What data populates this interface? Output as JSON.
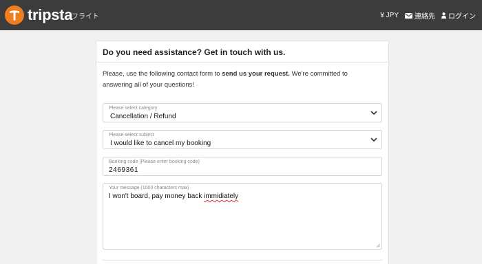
{
  "header": {
    "brand": "tripsta",
    "nav_flight": "フライト",
    "currency": "¥ JPY",
    "contact_label": "連絡先",
    "login_label": "ログイン"
  },
  "card": {
    "title": "Do you need assistance? Get in touch with us.",
    "intro_before": "Please, use the following contact form to ",
    "intro_bold": "send us your request.",
    "intro_after": " We're committed to answering all of your questions!"
  },
  "form": {
    "category": {
      "label": "Please select category",
      "value": "Cancellation / Refund"
    },
    "subject": {
      "label": "Please select subject",
      "value": "I would like to cancel my booking"
    },
    "booking": {
      "label": "Booking code (Please enter booking code)",
      "value": "2469361"
    },
    "message": {
      "label": "Your message (1000 characters max)",
      "value_before": "I won't board, pay money back ",
      "value_misspelled": "immidiately"
    }
  },
  "colors": {
    "brand_orange": "#f07d1e",
    "topbar": "#3c3c3c",
    "spellcheck": "#e03030"
  }
}
